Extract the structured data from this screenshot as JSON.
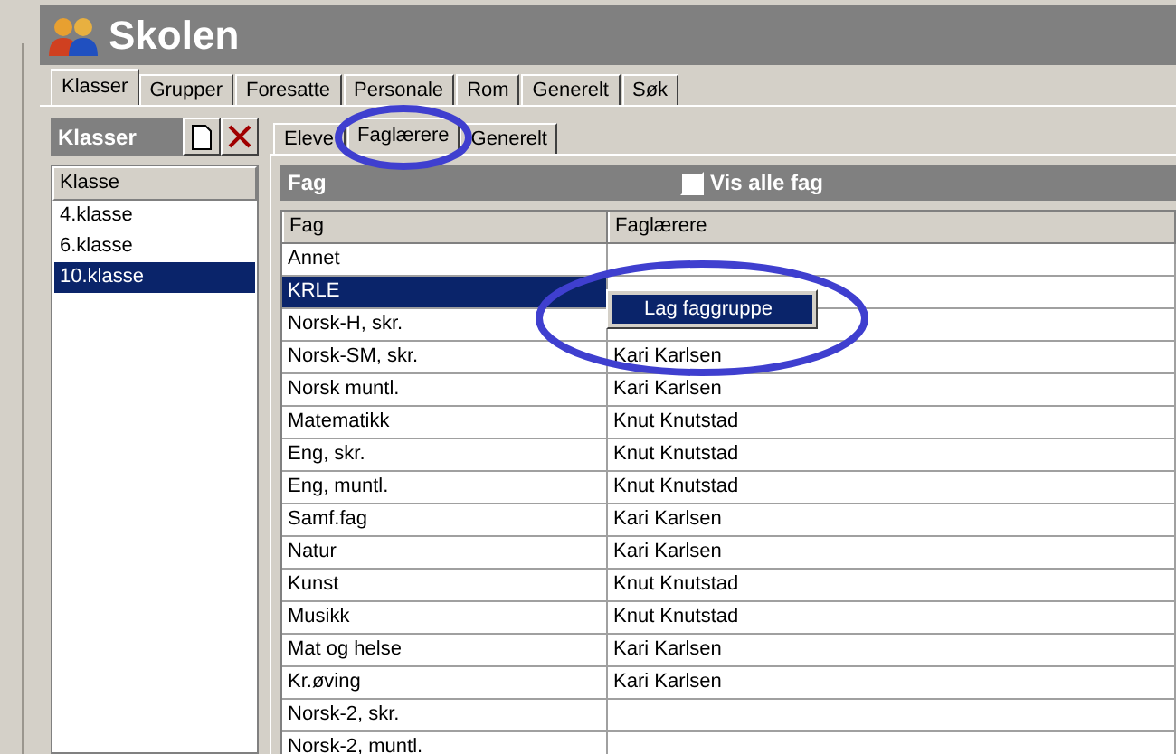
{
  "window": {
    "title": "Skolen"
  },
  "tabs": [
    {
      "label": "Klasser",
      "selected": true
    },
    {
      "label": "Grupper",
      "selected": false
    },
    {
      "label": "Foresatte",
      "selected": false
    },
    {
      "label": "Personale",
      "selected": false
    },
    {
      "label": "Rom",
      "selected": false
    },
    {
      "label": "Generelt",
      "selected": false
    },
    {
      "label": "Søk",
      "selected": false
    }
  ],
  "classes_panel": {
    "title": "Klasser",
    "column": "Klasse",
    "items": [
      {
        "label": "4.klasse",
        "selected": false
      },
      {
        "label": "6.klasse",
        "selected": false
      },
      {
        "label": "10.klasse",
        "selected": true
      }
    ]
  },
  "subtabs": [
    {
      "label": "Eleve",
      "selected": false
    },
    {
      "label": "Faglærere",
      "selected": true
    },
    {
      "label": "Generelt",
      "selected": false
    }
  ],
  "subjects_panel": {
    "title": "Fag",
    "show_all": {
      "label": "Vis alle fag",
      "checked": false
    },
    "columns": [
      "Fag",
      "Faglærere"
    ],
    "rows": [
      {
        "subject": "Annet",
        "teacher": "",
        "selected": false
      },
      {
        "subject": "KRLE",
        "teacher": "",
        "selected": true
      },
      {
        "subject": "Norsk-H, skr.",
        "teacher": "",
        "selected": false
      },
      {
        "subject": "Norsk-SM, skr.",
        "teacher": "Kari Karlsen",
        "selected": false
      },
      {
        "subject": "Norsk muntl.",
        "teacher": "Kari Karlsen",
        "selected": false
      },
      {
        "subject": "Matematikk",
        "teacher": "Knut Knutstad",
        "selected": false
      },
      {
        "subject": "Eng, skr.",
        "teacher": "Knut Knutstad",
        "selected": false
      },
      {
        "subject": "Eng, muntl.",
        "teacher": "Knut Knutstad",
        "selected": false
      },
      {
        "subject": "Samf.fag",
        "teacher": "Kari Karlsen",
        "selected": false
      },
      {
        "subject": "Natur",
        "teacher": "Kari Karlsen",
        "selected": false
      },
      {
        "subject": "Kunst",
        "teacher": "Knut Knutstad",
        "selected": false
      },
      {
        "subject": "Musikk",
        "teacher": "Knut Knutstad",
        "selected": false
      },
      {
        "subject": "Mat og helse",
        "teacher": "Kari Karlsen",
        "selected": false
      },
      {
        "subject": "Kr.øving",
        "teacher": "Kari Karlsen",
        "selected": false
      },
      {
        "subject": "Norsk-2, skr.",
        "teacher": "",
        "selected": false
      },
      {
        "subject": "Norsk-2, muntl.",
        "teacher": "",
        "selected": false
      }
    ]
  },
  "context_menu": {
    "items": [
      {
        "label": "Lag faggruppe",
        "selected": true
      }
    ]
  }
}
